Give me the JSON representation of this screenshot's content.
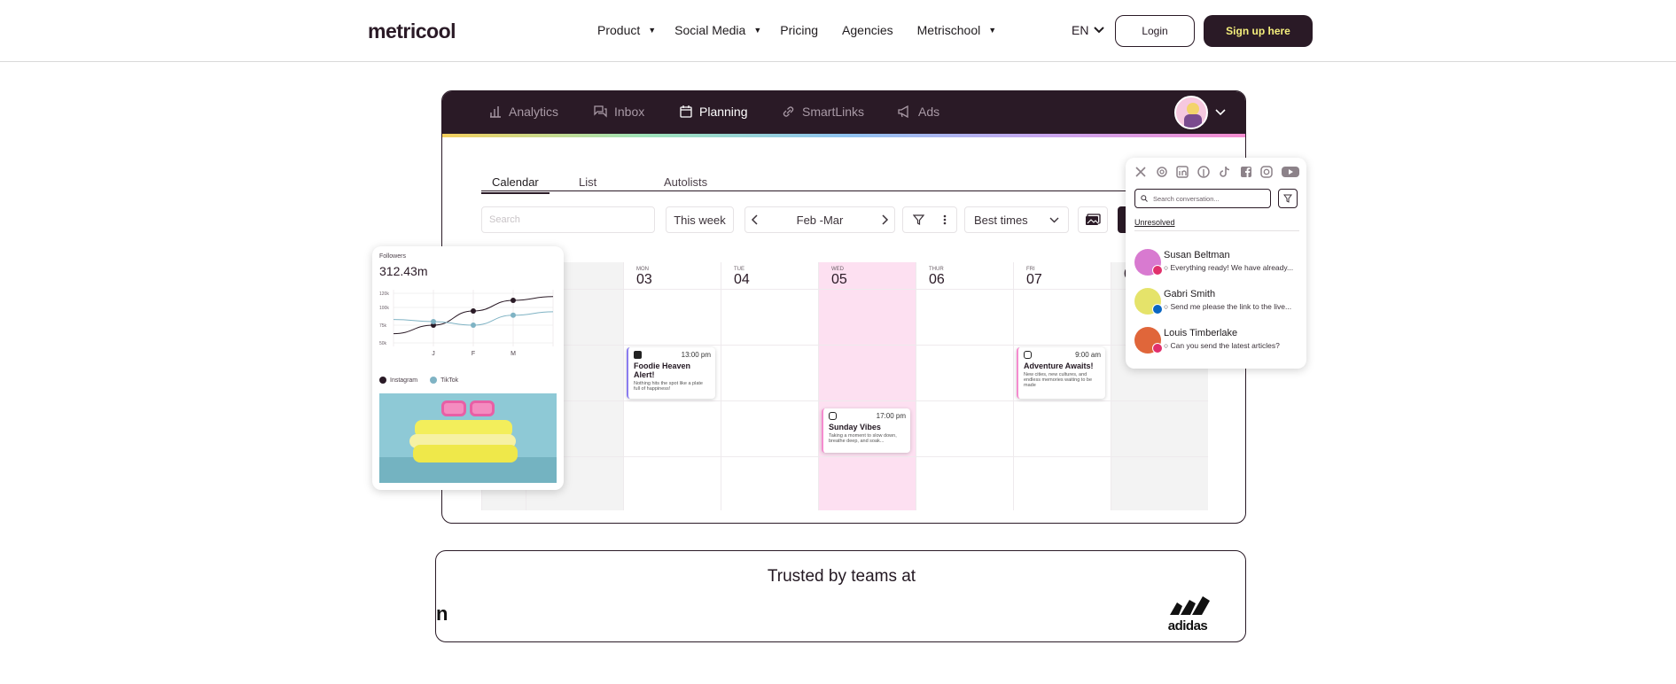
{
  "header": {
    "logo": "metricool",
    "nav": [
      {
        "label": "Product",
        "has_caret": true
      },
      {
        "label": "Social Media",
        "has_caret": true
      },
      {
        "label": "Pricing",
        "has_caret": false
      },
      {
        "label": "Agencies",
        "has_caret": false
      },
      {
        "label": "Metrischool",
        "has_caret": true
      }
    ],
    "language": "EN",
    "login_label": "Login",
    "signup_label": "Sign up here"
  },
  "app": {
    "tabs": [
      {
        "label": "Analytics",
        "icon": "bar-chart-icon",
        "active": false
      },
      {
        "label": "Inbox",
        "icon": "chat-icon",
        "active": false
      },
      {
        "label": "Planning",
        "icon": "calendar-icon",
        "active": true
      },
      {
        "label": "SmartLinks",
        "icon": "link-icon",
        "active": false
      },
      {
        "label": "Ads",
        "icon": "megaphone-icon",
        "active": false
      }
    ],
    "subtabs": [
      "Calendar",
      "List",
      "Autolists"
    ],
    "search_placeholder": "Search",
    "range_button": "This week",
    "date_range": "Feb -Mar",
    "best_times": "Best times",
    "days": [
      {
        "name": "",
        "num": ""
      },
      {
        "name": "MON",
        "num": "03"
      },
      {
        "name": "TUE",
        "num": "04"
      },
      {
        "name": "WED",
        "num": "05",
        "highlight": true
      },
      {
        "name": "THUR",
        "num": "06"
      },
      {
        "name": "FRI",
        "num": "07"
      },
      {
        "name": "",
        "num": "0"
      }
    ],
    "posts": [
      {
        "network": "facebook",
        "time": "13:00 pm",
        "title": "Foodie Heaven Alert!",
        "body": "Nothing hits the spot like a plate full of happiness!",
        "color": "#8a7cf0"
      },
      {
        "network": "instagram",
        "time": "17:00 pm",
        "title": "Sunday Vibes",
        "body": "Taking a moment to slow down, breathe deep, and soak...",
        "color": "#f58ccf"
      },
      {
        "network": "instagram",
        "time": "9:00 am",
        "title": "Adventure Awaits!",
        "body": "New cities, new cultures, and endless memories waiting to be made",
        "color": "#f58ccf"
      }
    ]
  },
  "followers_card": {
    "label": "Followers",
    "value": "312.43m",
    "y_ticks": [
      "120k",
      "100k",
      "75k",
      "50k"
    ],
    "x_ticks": [
      "J",
      "F",
      "M"
    ],
    "legend": [
      {
        "name": "Instagram",
        "color": "#2a1a26"
      },
      {
        "name": "TikTok",
        "color": "#7fb3c4"
      }
    ]
  },
  "chart_data": {
    "type": "line",
    "title": "Followers",
    "x": [
      "",
      "J",
      "F",
      "M",
      ""
    ],
    "series": [
      {
        "name": "Instagram",
        "color": "#2a1a26",
        "values": [
          null,
          75,
          95,
          110,
          null
        ]
      },
      {
        "name": "TikTok",
        "color": "#7fb3c4",
        "values": [
          null,
          80,
          75,
          89,
          null
        ]
      }
    ],
    "y_ticks": [
      "120k",
      "100k",
      "75k",
      "50k"
    ],
    "grid": true,
    "legend_position": "bottom"
  },
  "inbox_card": {
    "networks": [
      "x-icon",
      "threads-icon",
      "linkedin-icon",
      "pinterest-icon",
      "tiktok-icon",
      "facebook-icon",
      "instagram-icon",
      "youtube-icon"
    ],
    "search_placeholder": "Search conversation...",
    "filter_tab": "Unresolved",
    "conversations": [
      {
        "name": "Susan Beltman",
        "message": "Everything ready! We have already...",
        "avatar_color": "#d87ad0",
        "network_color": "#e1306c"
      },
      {
        "name": "Gabri Smith",
        "message": "Send me please the link to the live...",
        "avatar_color": "#e5e36a",
        "network_color": "#0a66c2"
      },
      {
        "name": "Louis Timberlake",
        "message": "Can you send the latest articles?",
        "avatar_color": "#e0663a",
        "network_color": "#e1306c"
      }
    ]
  },
  "trusted": {
    "title": "Trusted by teams at",
    "logos": [
      "n",
      "adidas"
    ]
  }
}
